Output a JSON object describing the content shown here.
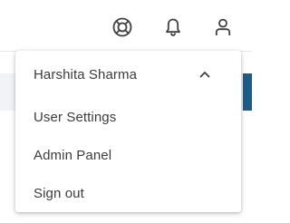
{
  "topbar": {
    "icons": [
      "help-lifebuoy-icon",
      "notifications-bell-icon",
      "user-account-icon"
    ]
  },
  "user_menu": {
    "user_name": "Harshita Sharma",
    "items": [
      {
        "label": "User Settings"
      },
      {
        "label": "Admin Panel"
      },
      {
        "label": "Sign out"
      }
    ]
  },
  "colors": {
    "text": "#3c3c3c",
    "icon": "#3f3f3f",
    "accent": "#1f5c86",
    "band": "#f1f3f6"
  }
}
